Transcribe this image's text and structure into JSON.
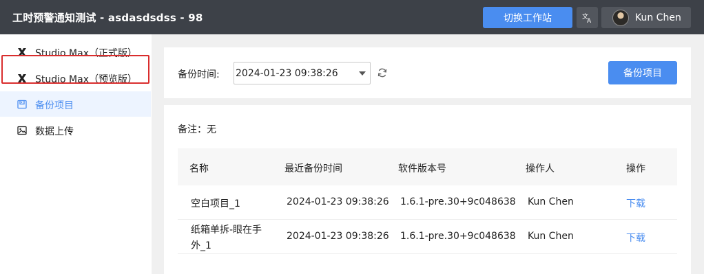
{
  "header": {
    "app_title": "工时预警通知测试 - asdasdsdss - 98",
    "switch_station_label": "切换工作站",
    "language_icon": "translate-icon",
    "user_name": "Kun Chen"
  },
  "sidebar": {
    "items": [
      {
        "label": "Studio Max（正式版）",
        "icon": "studio-max-logo-icon",
        "active": false
      },
      {
        "label": "Studio Max（预览版）",
        "icon": "studio-max-logo-icon",
        "active": false
      },
      {
        "label": "备份项目",
        "icon": "backup-icon",
        "active": true
      },
      {
        "label": "数据上传",
        "icon": "image-upload-icon",
        "active": false
      }
    ]
  },
  "toolbar": {
    "backup_time_label": "备份时间:",
    "selected_time": "2024-01-23 09:38:26",
    "backup_button_label": "备份项目"
  },
  "remark": "备注：无",
  "table": {
    "columns": [
      "名称",
      "最近备份时间",
      "软件版本号",
      "操作人",
      "操作"
    ],
    "rows": [
      {
        "name_line1": "空白项目_1",
        "name_line2": "",
        "time": "2024-01-23 09:38:26",
        "version": "1.6.1-pre.30+9c048638",
        "operator": "Kun Chen",
        "action": "下载"
      },
      {
        "name_line1": "纸箱单拆-眼在手",
        "name_line2": "外_1",
        "time": "2024-01-23 09:38:26",
        "version": "1.6.1-pre.30+9c048638",
        "operator": "Kun Chen",
        "action": "下载"
      }
    ]
  },
  "colors": {
    "accent": "#4a8df0",
    "topbar": "#3d4148",
    "highlight": "#d92d2d"
  }
}
